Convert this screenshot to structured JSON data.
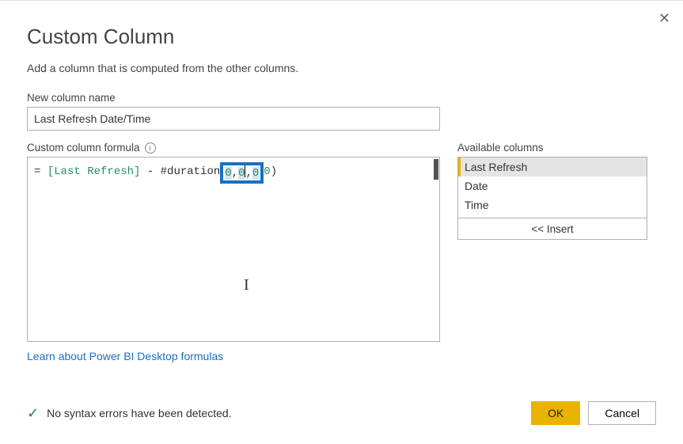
{
  "dialog": {
    "title": "Custom Column",
    "subtitle": "Add a column that is computed from the other columns.",
    "name_label": "New column name",
    "name_value": "Last Refresh Date/Time",
    "formula_label": "Custom column formula",
    "formula": {
      "eq": "= ",
      "col": "[Last Refresh]",
      "mid": " - #duration",
      "sel_a": "0",
      "sel_b": "0",
      "sel_c": "0",
      "tail_num": "0",
      "paren": ")"
    },
    "learn_link": "Learn about Power BI Desktop formulas",
    "available_label": "Available columns",
    "available_columns": [
      "Last Refresh",
      "Date",
      "Time"
    ],
    "insert_label": "<< Insert",
    "status": "No syntax errors have been detected.",
    "ok": "OK",
    "cancel": "Cancel"
  }
}
